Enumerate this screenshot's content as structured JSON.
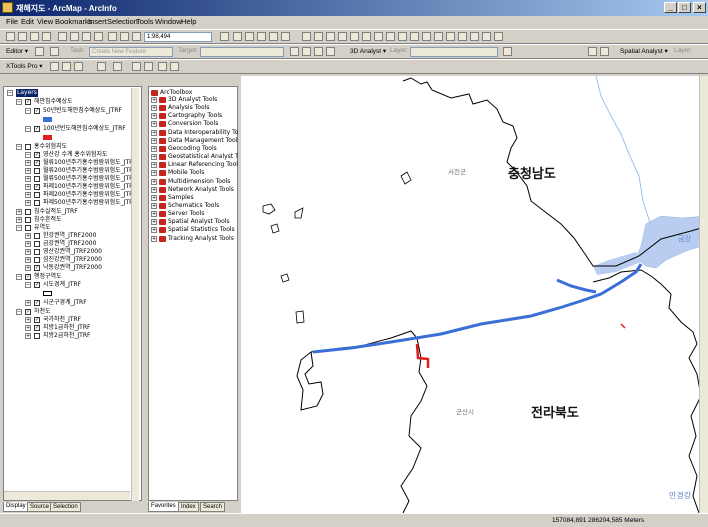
{
  "window": {
    "title": "재해지도 - ArcMap - ArcInfo"
  },
  "menu": [
    "File",
    "Edit",
    "View",
    "Bookmarks",
    "Insert",
    "Selection",
    "Tools",
    "Window",
    "Help"
  ],
  "toolbar1": {
    "scale": "1:98,494"
  },
  "toolbar2": {
    "editor_label": "Editor ▾",
    "task_label": "Task:",
    "task_value": "Create New Feature",
    "target_label": "Target:",
    "analyst_3d": "3D Analyst ▾",
    "layer_label": "Layer:",
    "spatial_analyst": "Spatial Analyst ▾",
    "layer_label2": "Layer:"
  },
  "toolbar3": {
    "xtools_label": "XTools Pro ▾"
  },
  "toc": {
    "root": "Layers",
    "items": [
      {
        "text": "해안침수예상도"
      },
      {
        "text": "50년빈도해안침수예상도_JTRF"
      },
      {
        "text": "100년빈도해안침수예상도_JTRF"
      },
      {
        "text": "홍수위험지도"
      },
      {
        "text": "영산강 수계 홍수위험지도"
      },
      {
        "text": "월류100년주기홍수범람위험도_JTRI"
      },
      {
        "text": "월류200년주기홍수범람위험도_JTRI"
      },
      {
        "text": "월류500년주기홍수범람위험도_JTRI"
      },
      {
        "text": "파제100년주기홍수범람위험도_JTRI"
      },
      {
        "text": "파제200년주기홍수범람위험도_JTRI"
      },
      {
        "text": "파제500년주기홍수범람위험도_JTRI"
      },
      {
        "text": "침수실적도_JTRF"
      },
      {
        "text": "침수흔적도"
      },
      {
        "text": "유역도"
      },
      {
        "text": "한강권역_JTRF2000"
      },
      {
        "text": "금강권역_JTRF2000"
      },
      {
        "text": "영산강권역_JTRF2000"
      },
      {
        "text": "섬진강권역_JTRF2000"
      },
      {
        "text": "낙동강권역_JTRF2000"
      },
      {
        "text": "행정구역도"
      },
      {
        "text": "시도경계_JTRF"
      },
      {
        "text": "시군구경계_JTRF"
      },
      {
        "text": "하천도"
      },
      {
        "text": "국가하천_JTRF"
      },
      {
        "text": "지방1급하천_JTRF"
      },
      {
        "text": "지방2급하천_JTRF"
      }
    ],
    "tabs": [
      "Display",
      "Source",
      "Selection"
    ]
  },
  "toolbox": {
    "root": "ArcToolbox",
    "items": [
      "3D Analyst Tools",
      "Analysis Tools",
      "Cartography Tools",
      "Conversion Tools",
      "Data Interoperability Tools",
      "Data Management Tools",
      "Geocoding Tools",
      "Geostatistical Analyst Tools",
      "Linear Referencing Tools",
      "Mobile Tools",
      "Multidimension Tools",
      "Network Analyst Tools",
      "Samples",
      "Schematics Tools",
      "Server Tools",
      "Spatial Analyst Tools",
      "Spatial Statistics Tools",
      "Tracking Analyst Tools"
    ],
    "tabs": [
      "Favorites",
      "Index",
      "Search"
    ]
  },
  "map": {
    "labels": {
      "chungnam": "충청남도",
      "seocheon": "서천군",
      "jeonbuk": "전라북도",
      "gunsan": "군산시",
      "geumgang": "금강",
      "mangyeong": "만경강"
    },
    "colors": {
      "river": "#b8cdf0",
      "flood50": "#3a6fd8",
      "flood100": "#e02020",
      "boundary": "#000000"
    }
  },
  "status": {
    "coords": "157084,891  286204,585 Meters"
  }
}
